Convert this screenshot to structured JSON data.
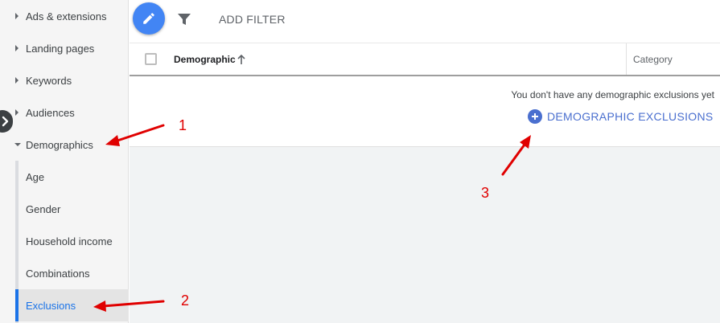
{
  "sidebar": {
    "items": [
      {
        "label": "Ads & extensions",
        "expanded": false
      },
      {
        "label": "Landing pages",
        "expanded": false
      },
      {
        "label": "Keywords",
        "expanded": false
      },
      {
        "label": "Audiences",
        "expanded": false
      },
      {
        "label": "Demographics",
        "expanded": true
      }
    ],
    "subitems": [
      {
        "label": "Age",
        "active": false
      },
      {
        "label": "Gender",
        "active": false
      },
      {
        "label": "Household income",
        "active": false
      },
      {
        "label": "Combinations",
        "active": false
      },
      {
        "label": "Exclusions",
        "active": true
      }
    ]
  },
  "toolbar": {
    "add_filter_label": "ADD FILTER"
  },
  "table": {
    "columns": [
      "Demographic",
      "Category"
    ],
    "empty_message": "You don't have any demographic exclusions yet",
    "add_exclusions_label": "DEMOGRAPHIC EXCLUSIONS"
  },
  "annotations": {
    "labels": [
      "1",
      "2",
      "3"
    ]
  },
  "colors": {
    "accent": "#1a73e8",
    "fab": "#4285f4",
    "link": "#4a6fcf",
    "annotation": "#e00000"
  }
}
